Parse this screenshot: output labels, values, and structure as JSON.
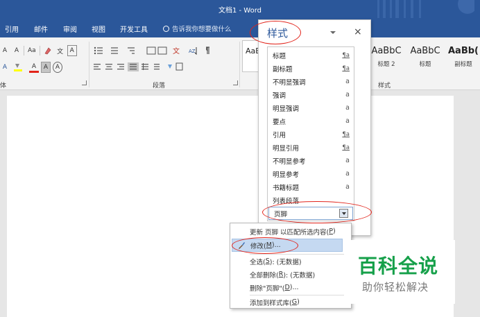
{
  "window": {
    "title": "文档1 - Word"
  },
  "tabs": [
    {
      "label": "引用"
    },
    {
      "label": "邮件"
    },
    {
      "label": "审阅"
    },
    {
      "label": "视图"
    },
    {
      "label": "开发工具"
    }
  ],
  "tell_me": {
    "placeholder": "告诉我你想要做什么"
  },
  "ribbon": {
    "font_group_label": "体",
    "paragraph_group_label": "段落",
    "styles_group_label": "样式",
    "font_row1": [
      "A",
      "A",
      "Aa",
      "文",
      "A"
    ],
    "font_row2": [
      "A",
      "A",
      "A",
      "A"
    ],
    "gallery": [
      {
        "sample": "AaBb",
        "name": ""
      },
      {
        "sample": "AaBbC",
        "name": "标题 2"
      },
      {
        "sample": "AaBbC",
        "name": "标题"
      },
      {
        "sample": "AaBb(",
        "name": "副标题"
      }
    ]
  },
  "styles_pane": {
    "title": "样式",
    "close_glyph": "×",
    "items": [
      {
        "name": "标题",
        "mark": "¶a"
      },
      {
        "name": "副标题",
        "mark": "¶a"
      },
      {
        "name": "不明显强调",
        "mark": "a"
      },
      {
        "name": "强调",
        "mark": "a"
      },
      {
        "name": "明显强调",
        "mark": "a"
      },
      {
        "name": "要点",
        "mark": "a"
      },
      {
        "name": "引用",
        "mark": "¶a"
      },
      {
        "name": "明显引用",
        "mark": "¶a"
      },
      {
        "name": "不明显参考",
        "mark": "a"
      },
      {
        "name": "明显参考",
        "mark": "a"
      },
      {
        "name": "书籍标题",
        "mark": "a"
      },
      {
        "name": "列表段落",
        "mark": ""
      },
      {
        "name": "页脚",
        "mark": ""
      }
    ]
  },
  "context_menu": {
    "update": {
      "before": "更新 页脚 以匹配所选内容(",
      "key": "P",
      "after": ")"
    },
    "modify": {
      "before": "修改(",
      "key": "M",
      "after": ")..."
    },
    "select_all": {
      "before": "全选(",
      "key": "S",
      "after": "): (无数据)"
    },
    "delete_all": {
      "before": "全部删除(",
      "key": "R",
      "after": "): (无数据)"
    },
    "delete": {
      "before": "删除\"页脚\"(",
      "key": "D",
      "after": ")..."
    },
    "add_gallery": {
      "before": "添加到样式库(",
      "key": "G",
      "after": ")"
    }
  },
  "watermark": {
    "line1": "百科全说",
    "line2": "助你轻松解决"
  },
  "colors": {
    "ribbon_blue": "#2b579a",
    "highlight": "#c5d9f1",
    "annotation_red": "#e2231a",
    "watermark_green": "#16a04a"
  },
  "icons": [
    "search-icon",
    "close-icon",
    "dropdown-arrow-icon",
    "format-brush-icon",
    "dialog-launcher-icon"
  ]
}
